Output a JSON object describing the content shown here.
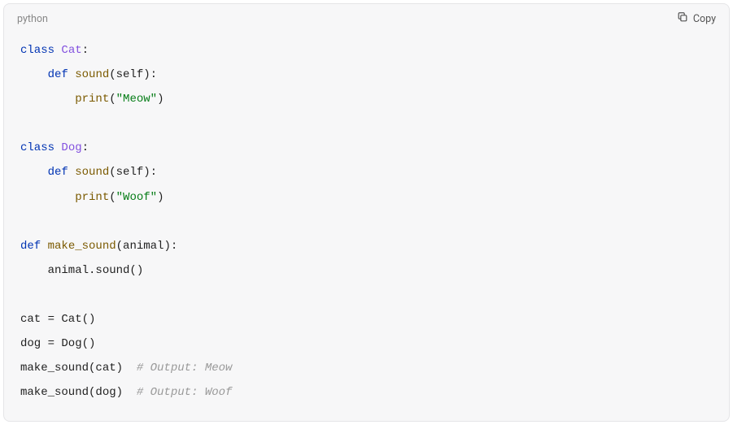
{
  "header": {
    "language": "python",
    "copy_label": "Copy"
  },
  "code": {
    "lines": [
      [
        {
          "cls": "tok-keyword",
          "t": "class"
        },
        {
          "cls": "tok-default",
          "t": " "
        },
        {
          "cls": "tok-classname",
          "t": "Cat"
        },
        {
          "cls": "tok-punct",
          "t": ":"
        }
      ],
      [
        {
          "cls": "tok-default",
          "t": "    "
        },
        {
          "cls": "tok-keyword",
          "t": "def"
        },
        {
          "cls": "tok-default",
          "t": " "
        },
        {
          "cls": "tok-funcname",
          "t": "sound"
        },
        {
          "cls": "tok-punct",
          "t": "("
        },
        {
          "cls": "tok-param",
          "t": "self"
        },
        {
          "cls": "tok-punct",
          "t": "):"
        }
      ],
      [
        {
          "cls": "tok-default",
          "t": "        "
        },
        {
          "cls": "tok-builtin",
          "t": "print"
        },
        {
          "cls": "tok-punct",
          "t": "("
        },
        {
          "cls": "tok-string",
          "t": "\"Meow\""
        },
        {
          "cls": "tok-punct",
          "t": ")"
        }
      ],
      [],
      [
        {
          "cls": "tok-keyword",
          "t": "class"
        },
        {
          "cls": "tok-default",
          "t": " "
        },
        {
          "cls": "tok-classname",
          "t": "Dog"
        },
        {
          "cls": "tok-punct",
          "t": ":"
        }
      ],
      [
        {
          "cls": "tok-default",
          "t": "    "
        },
        {
          "cls": "tok-keyword",
          "t": "def"
        },
        {
          "cls": "tok-default",
          "t": " "
        },
        {
          "cls": "tok-funcname",
          "t": "sound"
        },
        {
          "cls": "tok-punct",
          "t": "("
        },
        {
          "cls": "tok-param",
          "t": "self"
        },
        {
          "cls": "tok-punct",
          "t": "):"
        }
      ],
      [
        {
          "cls": "tok-default",
          "t": "        "
        },
        {
          "cls": "tok-builtin",
          "t": "print"
        },
        {
          "cls": "tok-punct",
          "t": "("
        },
        {
          "cls": "tok-string",
          "t": "\"Woof\""
        },
        {
          "cls": "tok-punct",
          "t": ")"
        }
      ],
      [],
      [
        {
          "cls": "tok-keyword",
          "t": "def"
        },
        {
          "cls": "tok-default",
          "t": " "
        },
        {
          "cls": "tok-funcname",
          "t": "make_sound"
        },
        {
          "cls": "tok-punct",
          "t": "("
        },
        {
          "cls": "tok-param",
          "t": "animal"
        },
        {
          "cls": "tok-punct",
          "t": "):"
        }
      ],
      [
        {
          "cls": "tok-default",
          "t": "    animal.sound()"
        }
      ],
      [],
      [
        {
          "cls": "tok-default",
          "t": "cat = Cat()"
        }
      ],
      [
        {
          "cls": "tok-default",
          "t": "dog = Dog()"
        }
      ],
      [
        {
          "cls": "tok-default",
          "t": "make_sound(cat)  "
        },
        {
          "cls": "tok-comment",
          "t": "# Output: Meow"
        }
      ],
      [
        {
          "cls": "tok-default",
          "t": "make_sound(dog)  "
        },
        {
          "cls": "tok-comment",
          "t": "# Output: Woof"
        }
      ]
    ]
  }
}
